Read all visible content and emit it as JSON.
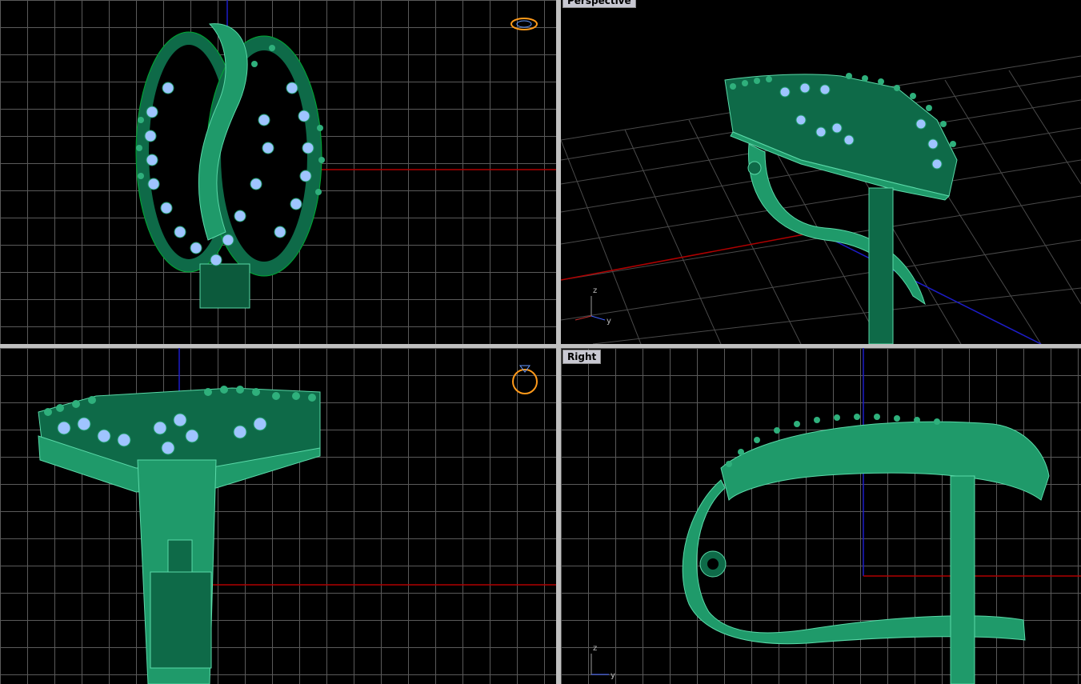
{
  "viewports": {
    "top": {
      "label": ""
    },
    "perspective": {
      "label": "Perspective"
    },
    "front": {
      "label": ""
    },
    "right": {
      "label": "Right"
    }
  },
  "axes": {
    "z": "z",
    "y": "y"
  },
  "colors": {
    "background": "#000000",
    "grid": "#5a5a5a",
    "x_axis": "#b00000",
    "y_axis": "#1c1cc8",
    "model_green": "#1f9a6a",
    "model_highlight": "#5ad9a8",
    "gem_blue": "#9fc4ff",
    "label_bg": "#c8c8d2"
  },
  "icons": {
    "top": "ring-top-orientation-icon",
    "front": "ring-front-orientation-icon"
  }
}
